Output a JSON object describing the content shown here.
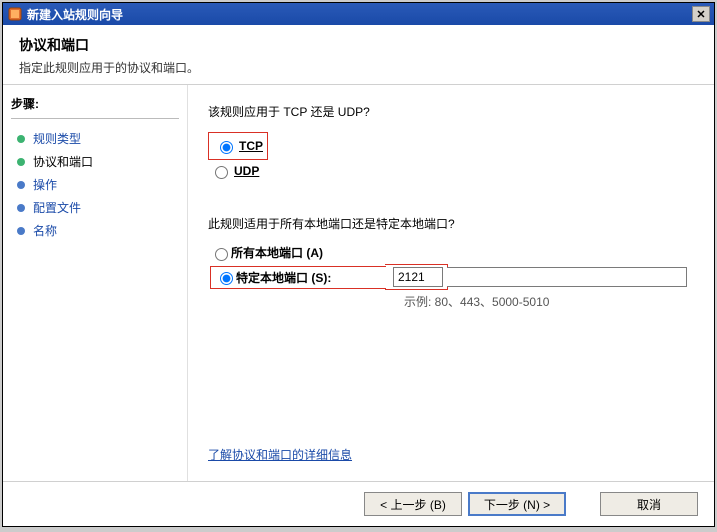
{
  "window": {
    "title": "新建入站规则向导"
  },
  "header": {
    "title": "协议和端口",
    "subtitle": "指定此规则应用于的协议和端口。"
  },
  "sidebar": {
    "steps_label": "步骤:",
    "items": [
      {
        "label": "规则类型",
        "bullet": "green",
        "link": true
      },
      {
        "label": "协议和端口",
        "bullet": "green",
        "link": false
      },
      {
        "label": "操作",
        "bullet": "blue",
        "link": true
      },
      {
        "label": "配置文件",
        "bullet": "blue",
        "link": true
      },
      {
        "label": "名称",
        "bullet": "blue",
        "link": true
      }
    ]
  },
  "content": {
    "q_protocol": "该规则应用于 TCP 还是 UDP?",
    "opt_tcp": "TCP",
    "opt_udp": "UDP",
    "q_ports": "此规则适用于所有本地端口还是特定本地端口?",
    "opt_all_ports": "所有本地端口 (A)",
    "opt_specific_ports": "特定本地端口 (S):",
    "port_value": "2121",
    "example_text": "示例: 80、443、5000-5010",
    "learn_more": "了解协议和端口的详细信息"
  },
  "footer": {
    "back": "< 上一步 (B)",
    "next": "下一步 (N) >",
    "cancel": "取消"
  }
}
